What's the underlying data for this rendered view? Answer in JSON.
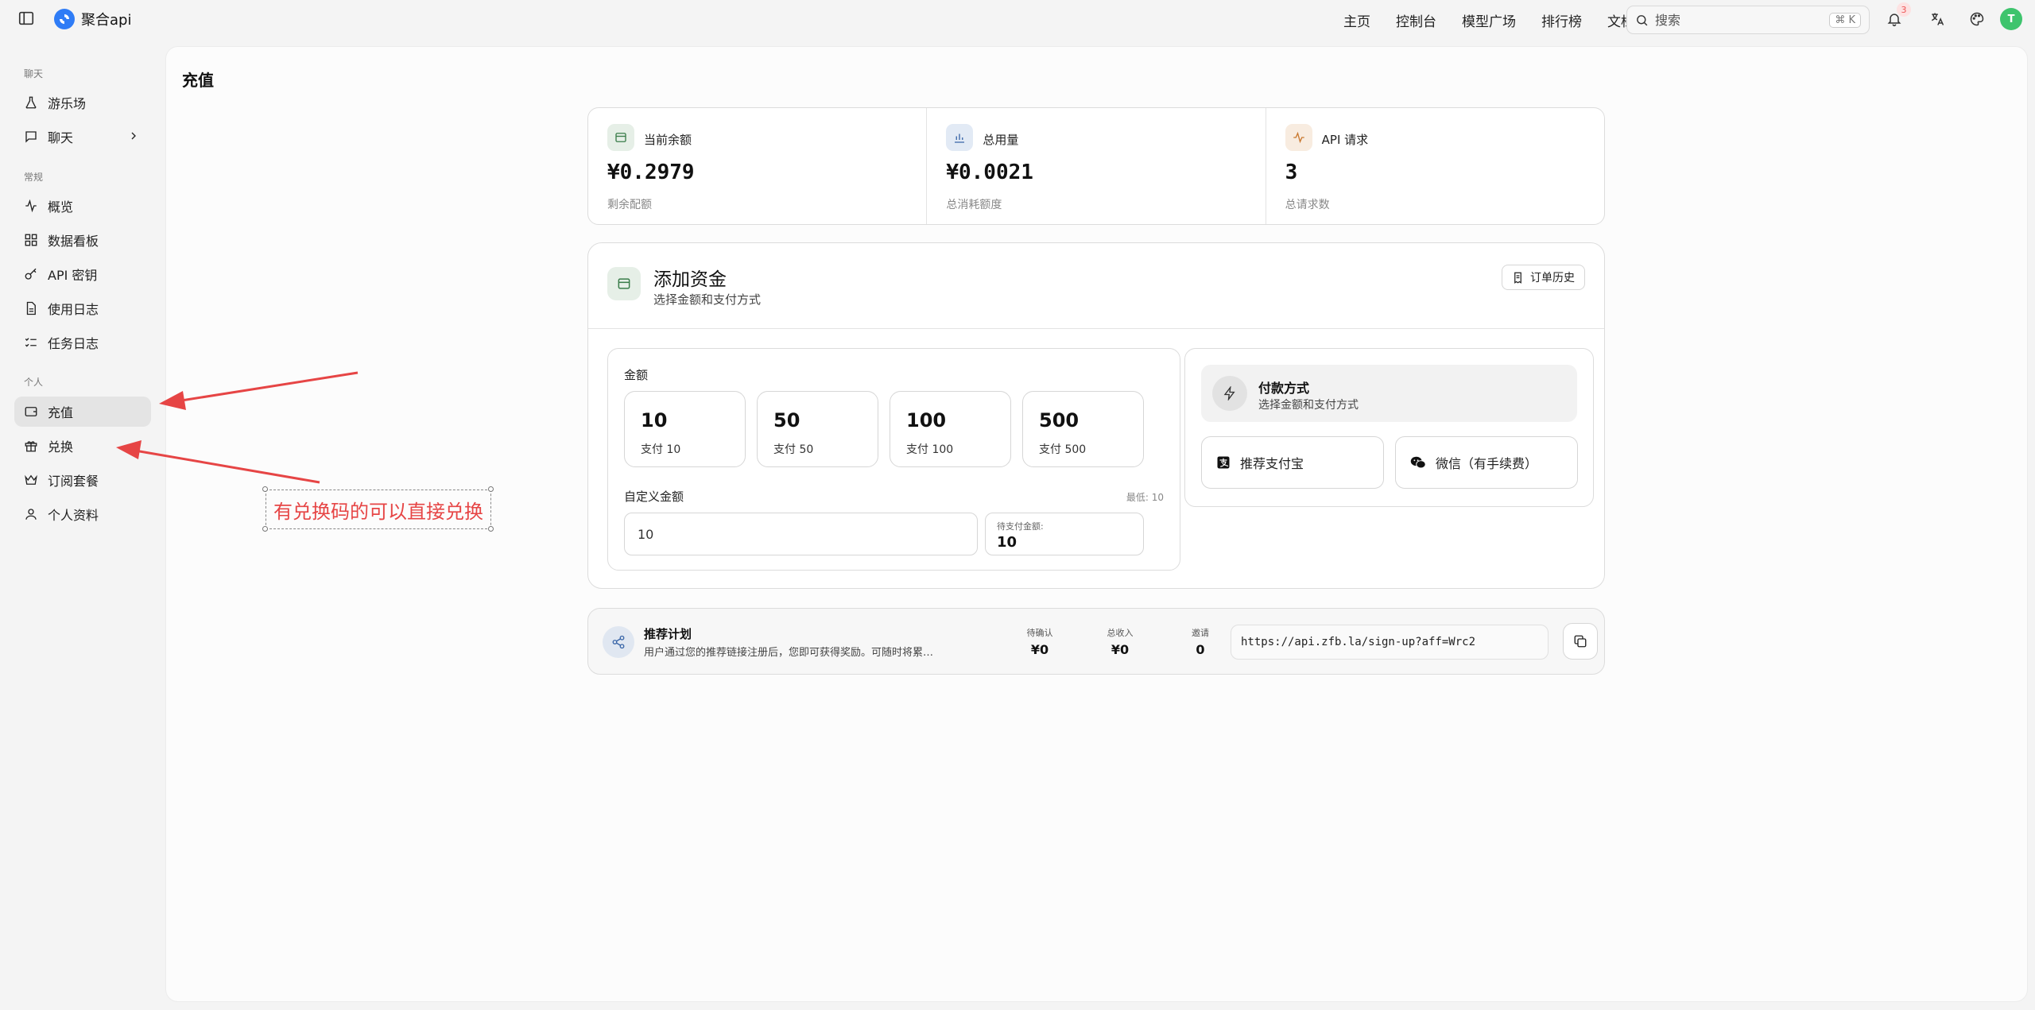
{
  "brand": {
    "name": "聚合api"
  },
  "nav": [
    "主页",
    "控制台",
    "模型广场",
    "排行榜",
    "文档"
  ],
  "search": {
    "placeholder": "搜索",
    "shortcut": "⌘ K"
  },
  "notifications": {
    "count": "3"
  },
  "user": {
    "avatar_letter": "T"
  },
  "sidebar": {
    "sections": [
      "聊天",
      "常规",
      "个人"
    ],
    "items": [
      "游乐场",
      "聊天",
      "概览",
      "数据看板",
      "API 密钥",
      "使用日志",
      "任务日志",
      "充值",
      "兑换",
      "订阅套餐",
      "个人资料"
    ]
  },
  "page": {
    "title": "充值"
  },
  "stats": [
    {
      "label": "当前余额",
      "value": "¥0.2979",
      "sub": "剩余配额"
    },
    {
      "label": "总用量",
      "value": "¥0.0021",
      "sub": "总消耗额度"
    },
    {
      "label": "API 请求",
      "value": "3",
      "sub": "总请求数"
    }
  ],
  "fund": {
    "title": "添加资金",
    "subtitle": "选择金额和支付方式",
    "history_label": "订单历史",
    "amount_label": "金额",
    "presets": [
      {
        "value": "10",
        "sub": "支付 10"
      },
      {
        "value": "50",
        "sub": "支付 50"
      },
      {
        "value": "100",
        "sub": "支付 100"
      },
      {
        "value": "500",
        "sub": "支付 500"
      }
    ],
    "custom_label": "自定义金额",
    "min_label": "最低: 10",
    "custom_value": "10",
    "to_pay_label": "待支付金额:",
    "to_pay_value": "10"
  },
  "payment": {
    "title": "付款方式",
    "subtitle": "选择金额和支付方式",
    "alipay": "推荐支付宝",
    "wechat": "微信（有手续费）"
  },
  "referral": {
    "title": "推荐计划",
    "desc": "用户通过您的推荐链接注册后，您即可获得奖励。可随时将累…",
    "pending_label": "待确认",
    "pending_value": "¥0",
    "income_label": "总收入",
    "income_value": "¥0",
    "invites_label": "邀请",
    "invites_value": "0",
    "link": "https://api.zfb.la/sign-up?aff=Wrc2"
  },
  "annotation": {
    "text": "有兑换码的可以直接兑换",
    "color": "#e64545"
  },
  "colors": {
    "accent": "#2f7cf6",
    "annotation": "#e64545",
    "avatar": "#3ec46d"
  }
}
